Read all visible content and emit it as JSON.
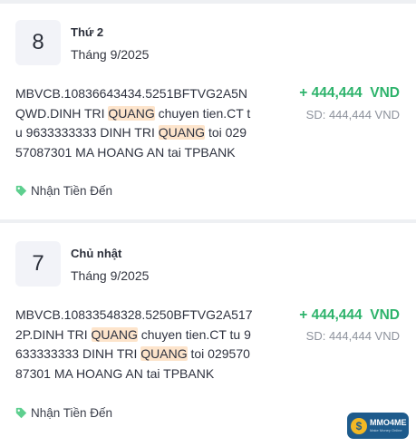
{
  "transactions": [
    {
      "day": "8",
      "weekday": "Thứ 2",
      "month": "Tháng 9/2025",
      "description_parts": [
        "MBVCB.10836643434.5251BFTVG2A5NQWD.DINH TRI ",
        "QUANG",
        " chuyen tien.CT tu 9633333333 DINH TRI ",
        "QUANG",
        " toi 02957087301 MA HOANG AN tai TPBANK"
      ],
      "amount": "+ 444,444  VND",
      "balance": "SD: 444,444 VND",
      "tag": "Nhận Tiền Đến"
    },
    {
      "day": "7",
      "weekday": "Chủ nhật",
      "month": "Tháng 9/2025",
      "description_parts": [
        "MBVCB.10833548328.5250BFTVG2A5172P.DINH TRI ",
        "QUANG",
        " chuyen tien.CT tu 9633333333 DINH TRI ",
        "QUANG",
        " toi 02957087301 MA HOANG AN tai TPBANK"
      ],
      "amount": "+ 444,444  VND",
      "balance": "SD: 444,444 VND",
      "tag": "Nhận Tiền Đến"
    }
  ],
  "icons": {
    "tag": "tag-icon",
    "badge": "dollar-coin-icon"
  },
  "colors": {
    "amount": "#2db36b",
    "highlight": "#fde4cb",
    "badge": "#1e5b8c"
  },
  "badge": {
    "symbol": "$",
    "name": "MMO4ME",
    "subtitle": "Make Money Online"
  }
}
